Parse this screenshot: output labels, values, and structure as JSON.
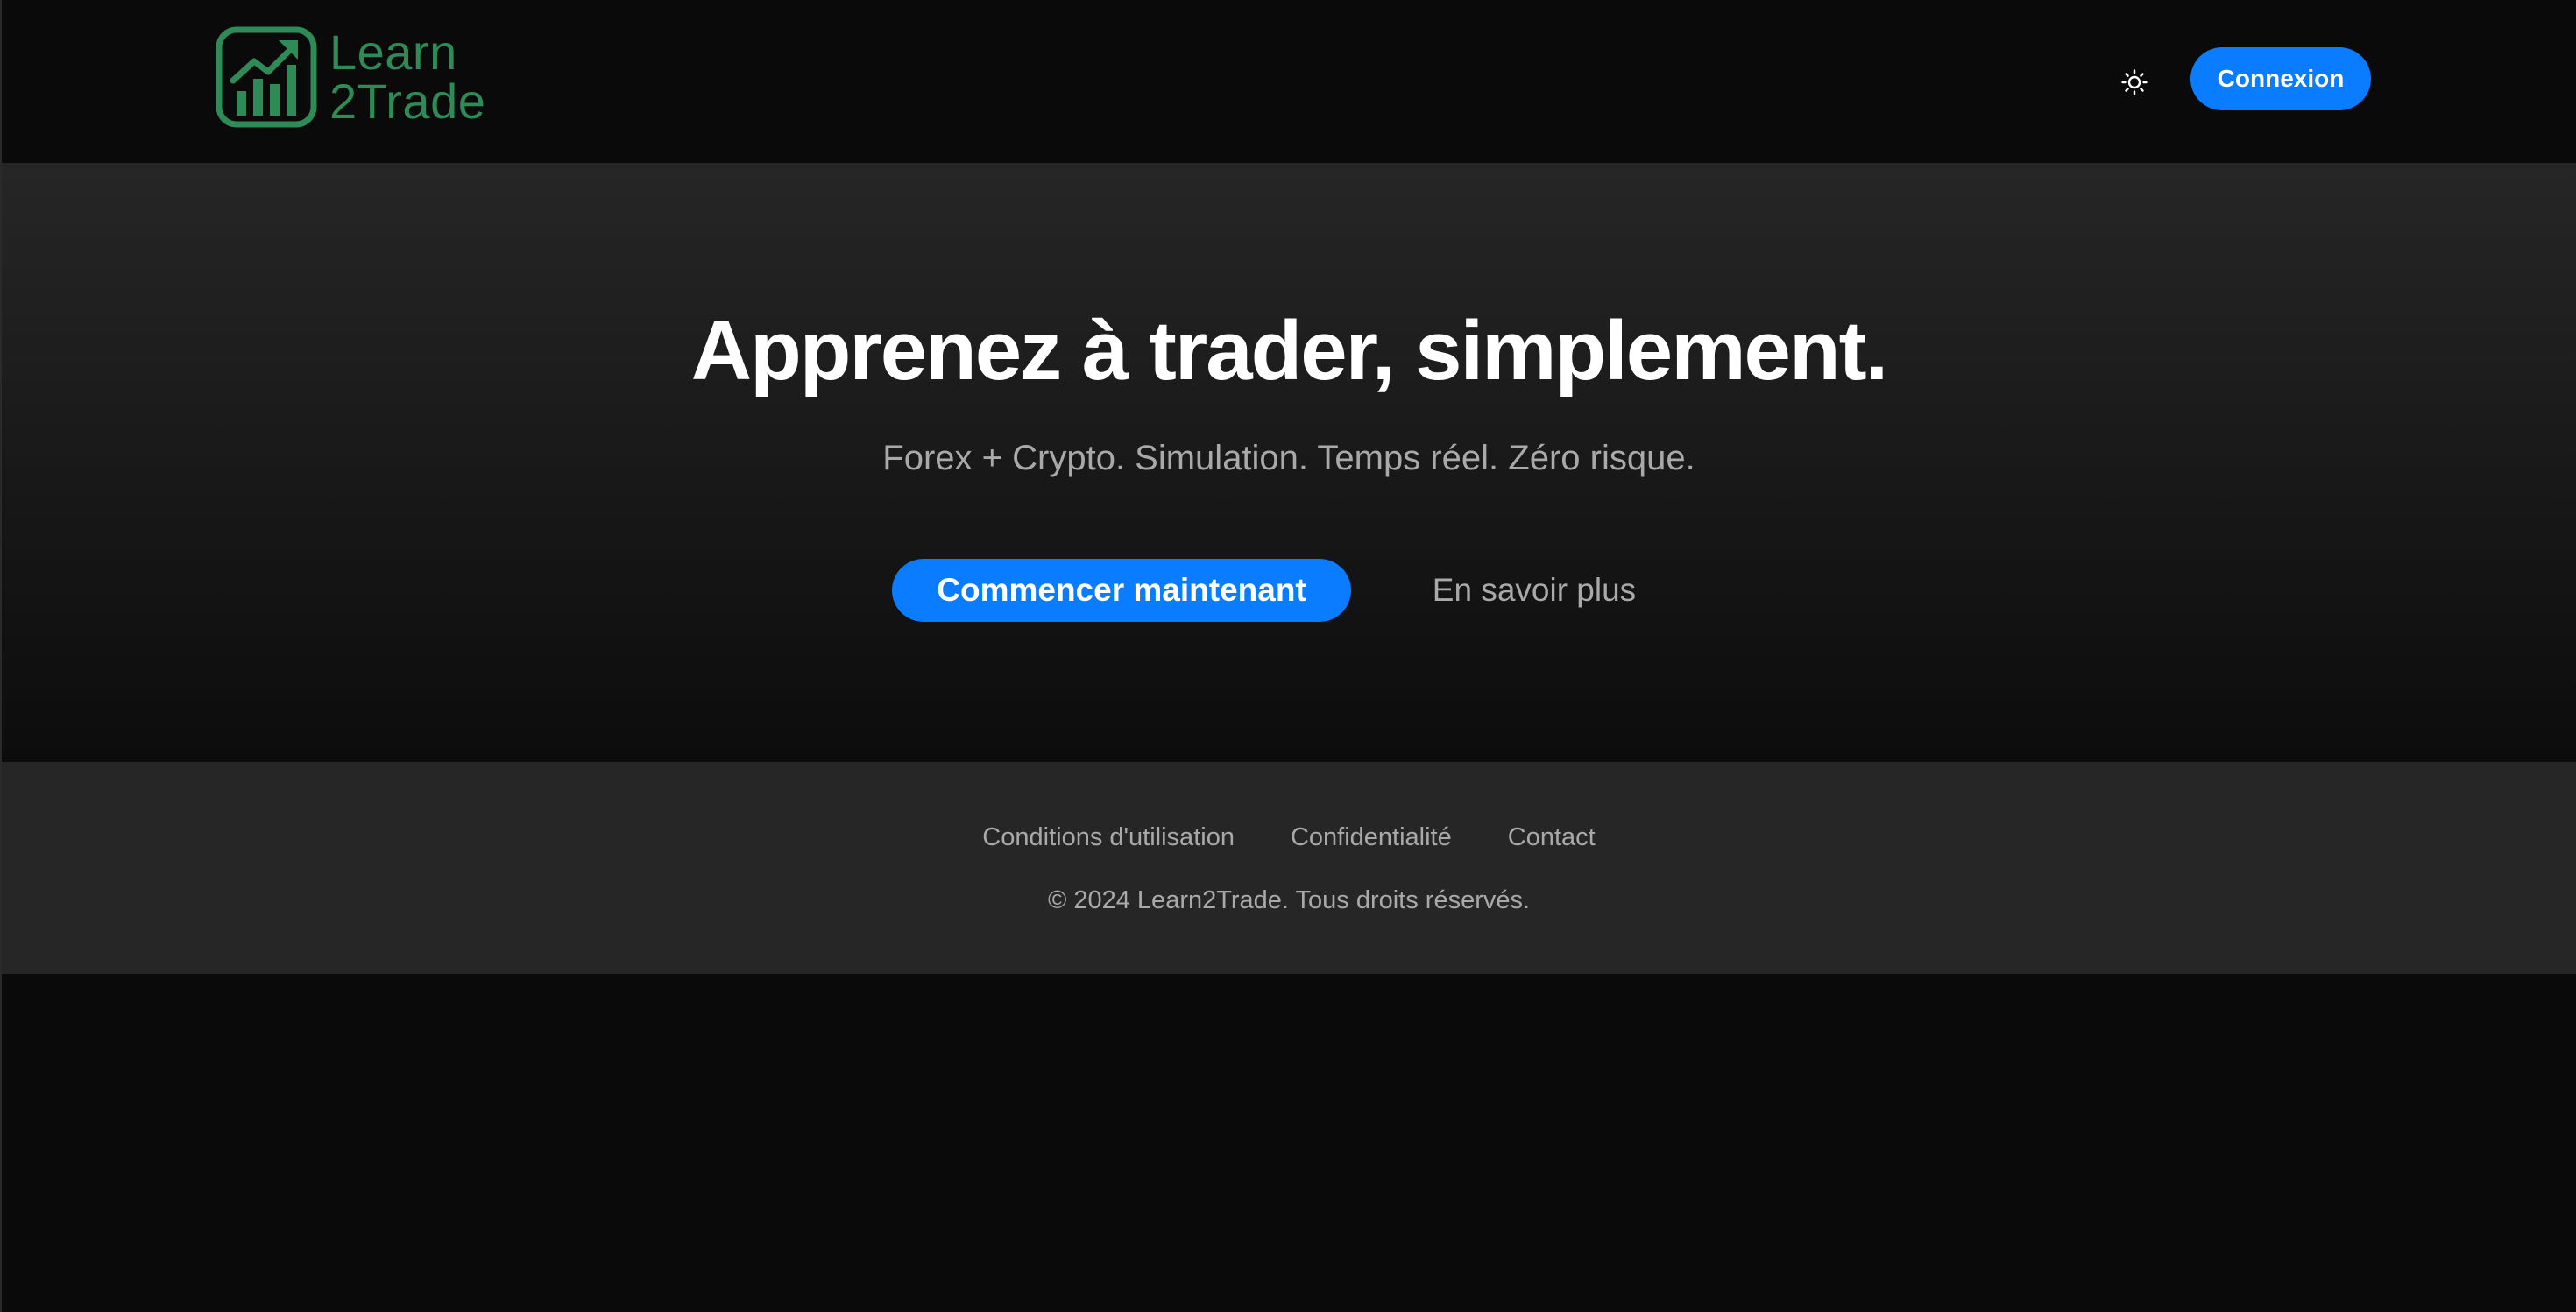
{
  "brand": {
    "line1": "Learn",
    "line2": "2Trade",
    "color": "#2e8b57",
    "logo_icon": "growth-chart-icon"
  },
  "header": {
    "theme_toggle_icon": "sun-icon",
    "login_label": "Connexion"
  },
  "hero": {
    "title": "Apprenez à trader, simplement.",
    "subtitle": "Forex + Crypto. Simulation. Temps réel. Zéro risque.",
    "primary_cta": "Commencer maintenant",
    "secondary_cta": "En savoir plus"
  },
  "footer": {
    "links": [
      "Conditions d'utilisation",
      "Confidentialité",
      "Contact"
    ],
    "copyright": "© 2024 Learn2Trade. Tous droits réservés."
  },
  "colors": {
    "accent": "#0a7cff",
    "background": "#0a0a0a",
    "muted_text": "#a9a9a9"
  }
}
